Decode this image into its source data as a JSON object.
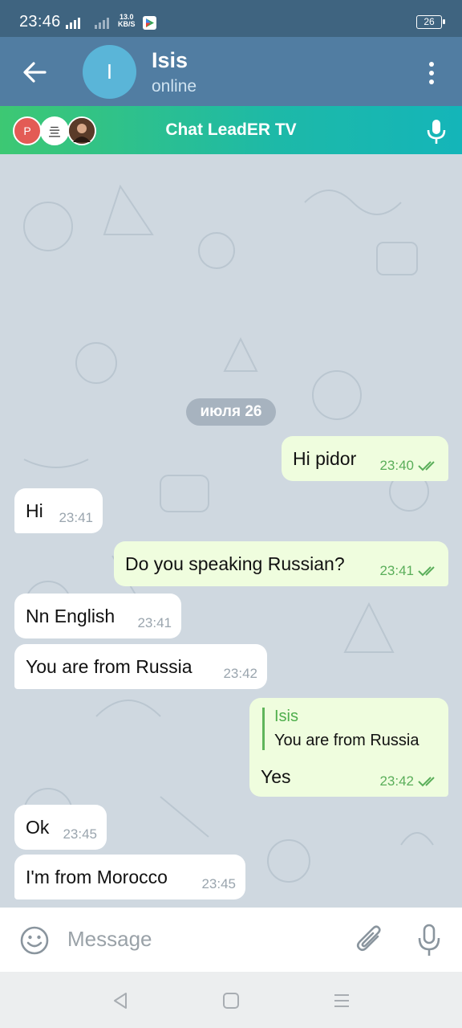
{
  "status_bar": {
    "time": "23:46",
    "net_speed": "13.0",
    "net_unit": "KB/S",
    "battery": "26"
  },
  "header": {
    "back_icon": "arrow-left-icon",
    "avatar_initial": "I",
    "contact_name": "Isis",
    "contact_status": "online",
    "menu_icon": "more-vertical-icon"
  },
  "voice_chat": {
    "title": "Chat LeadER TV",
    "participants": [
      "P",
      "亖",
      ""
    ]
  },
  "date_divider": "июля 26",
  "messages": [
    {
      "direction": "out",
      "text": "Hi pidor",
      "time": "23:40",
      "read": true
    },
    {
      "direction": "in",
      "text": "Hi",
      "time": "23:41"
    },
    {
      "direction": "out",
      "text": "Do you speaking Russian?",
      "time": "23:41",
      "read": true
    },
    {
      "direction": "in",
      "text": "Nn English",
      "time": "23:41"
    },
    {
      "direction": "in",
      "text": "You are from Russia",
      "time": "23:42"
    },
    {
      "direction": "out",
      "reply_to_name": "Isis",
      "reply_to_text": "You are from Russia",
      "text": "Yes",
      "time": "23:42",
      "read": true
    },
    {
      "direction": "in",
      "text": "Ok",
      "time": "23:45"
    },
    {
      "direction": "in",
      "text": "I'm from Morocco",
      "time": "23:45"
    }
  ],
  "input": {
    "placeholder": "Message"
  },
  "colors": {
    "header": "#517da2",
    "status_bar": "#3f6480",
    "incoming_bubble": "#ffffff",
    "outgoing_bubble": "#effdde",
    "outgoing_meta": "#5aae5a",
    "banner_start": "#3dc873",
    "banner_end": "#14b5b9"
  }
}
